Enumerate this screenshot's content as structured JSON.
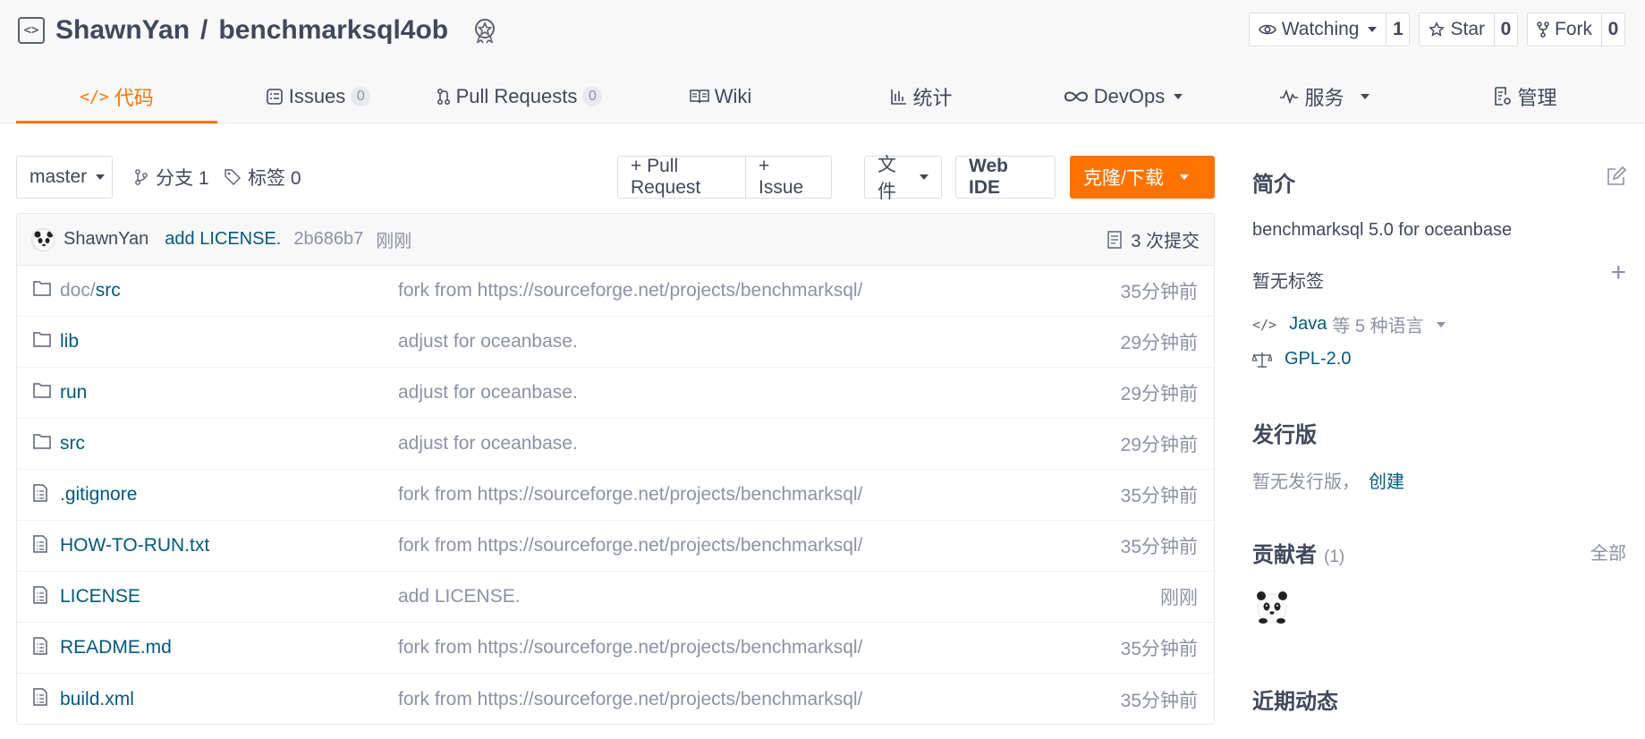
{
  "repo": {
    "owner": "ShawnYan",
    "separator": "/",
    "name": "benchmarksql4ob"
  },
  "actions": {
    "watch": {
      "label": "Watching",
      "count": "1"
    },
    "star": {
      "label": "Star",
      "count": "0"
    },
    "fork": {
      "label": "Fork",
      "count": "0"
    }
  },
  "tabs": [
    {
      "label": "代码",
      "icon": "code-icon"
    },
    {
      "label": "Issues",
      "icon": "issues-icon",
      "count": "0"
    },
    {
      "label": "Pull Requests",
      "icon": "pull-request-icon",
      "count": "0"
    },
    {
      "label": "Wiki",
      "icon": "book-icon"
    },
    {
      "label": "统计",
      "icon": "bar-chart-icon"
    },
    {
      "label": "DevOps",
      "icon": "infinity-icon"
    },
    {
      "label": "服务",
      "icon": "pulse-icon"
    },
    {
      "label": "管理",
      "icon": "doc-settings-icon"
    }
  ],
  "toolbar": {
    "branch": "master",
    "branches_label": "分支 1",
    "tags_label": "标签 0",
    "pull_request_btn": "+ Pull Request",
    "issue_btn": "+ Issue",
    "file_btn": "文件",
    "webide_btn": "Web IDE",
    "clone_btn": "克隆/下载"
  },
  "commit": {
    "author": "ShawnYan",
    "message": "add LICENSE.",
    "hash": "2b686b7",
    "time": "刚刚",
    "commits_label": "3 次提交"
  },
  "files": [
    {
      "prefix": "doc/",
      "name": "src",
      "type": "folder",
      "message": "fork from https://sourceforge.net/projects/benchmarksql/",
      "time": "35分钟前"
    },
    {
      "prefix": "",
      "name": "lib",
      "type": "folder",
      "message": "adjust for oceanbase.",
      "time": "29分钟前"
    },
    {
      "prefix": "",
      "name": "run",
      "type": "folder",
      "message": "adjust for oceanbase.",
      "time": "29分钟前"
    },
    {
      "prefix": "",
      "name": "src",
      "type": "folder",
      "message": "adjust for oceanbase.",
      "time": "29分钟前"
    },
    {
      "prefix": "",
      "name": ".gitignore",
      "type": "file",
      "message": "fork from https://sourceforge.net/projects/benchmarksql/",
      "time": "35分钟前"
    },
    {
      "prefix": "",
      "name": "HOW-TO-RUN.txt",
      "type": "file",
      "message": "fork from https://sourceforge.net/projects/benchmarksql/",
      "time": "35分钟前"
    },
    {
      "prefix": "",
      "name": "LICENSE",
      "type": "file",
      "message": "add LICENSE.",
      "time": "刚刚"
    },
    {
      "prefix": "",
      "name": "README.md",
      "type": "file",
      "message": "fork from https://sourceforge.net/projects/benchmarksql/",
      "time": "35分钟前"
    },
    {
      "prefix": "",
      "name": "build.xml",
      "type": "file",
      "message": "fork from https://sourceforge.net/projects/benchmarksql/",
      "time": "35分钟前"
    }
  ],
  "sidebar": {
    "intro_title": "简介",
    "intro_text": "benchmarksql 5.0 for oceanbase",
    "no_tags": "暂无标签",
    "language_link": "Java",
    "language_suffix": "等 5 种语言",
    "license": "GPL-2.0",
    "release_title": "发行版",
    "no_release": "暂无发行版，",
    "create_link": "创建",
    "contributors_title": "贡献者",
    "contributors_count": "(1)",
    "all_link": "全部",
    "activity_title": "近期动态"
  },
  "colors": {
    "accent": "#fe7300",
    "link": "#005980",
    "text": "#40485b",
    "muted": "#8c92a4"
  }
}
